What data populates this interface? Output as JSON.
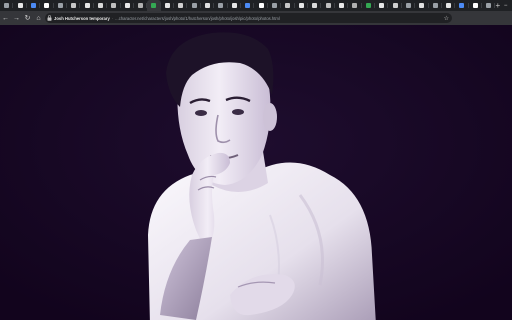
{
  "browser": {
    "tab_count": 37,
    "active_tab_index": 11,
    "new_tab_symbol": "+",
    "window_controls": [
      "−",
      "□",
      "✕"
    ]
  },
  "toolbar": {
    "back_icon": "←",
    "forward_icon": "→",
    "reload_icon": "↻",
    "home_icon": "⌂",
    "page_title": "Josh Hutcherson temporary",
    "url_path": "...character.net/characters/josh/photo/1/hutcherson/josh/photo/josh/pic/photo/photos.html",
    "bookmark_icon": "☆"
  },
  "content": {
    "image_alt": "Black and white portrait of a young man in a white t-shirt with his hand near his chin",
    "colors": {
      "background": "#13061f",
      "shirt": "#f1eef5",
      "skin": "#e9e2ee",
      "hair": "#1a0f24"
    }
  }
}
